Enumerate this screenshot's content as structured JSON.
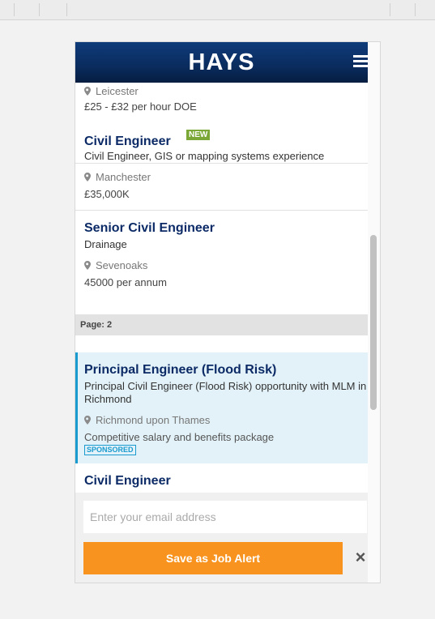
{
  "brand": {
    "name": "HAYS",
    "header_color": "#0b2a66",
    "accent": "#f7931e"
  },
  "jobs_top": [
    {
      "title": "",
      "description": "",
      "location": "Leicester",
      "salary": "£25 - £32 per hour DOE",
      "badge": ""
    },
    {
      "title": "Civil Engineer",
      "description": "Civil Engineer, GIS or mapping systems experience",
      "location": "Manchester",
      "salary": "£35,000K",
      "badge": "NEW"
    },
    {
      "title": "Senior Civil Engineer",
      "description": "Drainage",
      "location": "Sevenoaks",
      "salary": "45000 per annum",
      "badge": ""
    }
  ],
  "page_label": "Page: 2",
  "sponsored_job": {
    "title": "Principal Engineer (Flood Risk)",
    "description": "Principal Civil Engineer (Flood Risk) opportunity with MLM in Richmond",
    "location": "Richmond upon Thames",
    "salary": "Competitive salary and benefits package",
    "badge": "SPONSORED"
  },
  "next_job": {
    "title": "Civil Engineer"
  },
  "job_alert": {
    "email_placeholder": "Enter your email address",
    "email_value": "",
    "save_label": "Save as Job Alert",
    "close_icon": "×"
  }
}
